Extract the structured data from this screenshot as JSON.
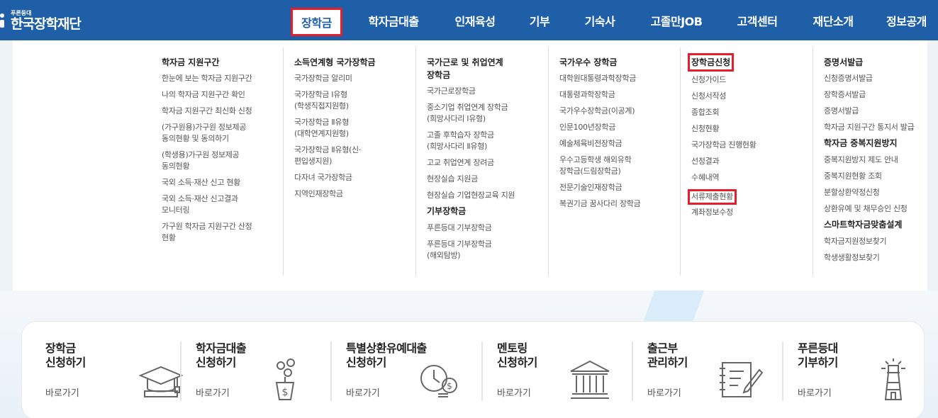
{
  "header": {
    "logo_sub": "푸른등대",
    "logo_main": "한국장학재단",
    "nav": [
      {
        "label": "장학금",
        "active": true
      },
      {
        "label": "학자금대출"
      },
      {
        "label": "인재육성"
      },
      {
        "label": "기부"
      },
      {
        "label": "기숙사"
      },
      {
        "label": "고졸만JOB"
      },
      {
        "label": "고객센터"
      },
      {
        "label": "재단소개"
      },
      {
        "label": "정보공개"
      }
    ]
  },
  "menu": {
    "col1": {
      "title": "학자금 지원구간",
      "links": [
        "한눈에 보는 학자금 지원구간",
        "나의 학자금 지원구간 확인",
        "학자금 지원구간 최신화 신청",
        "(가구원용)가구원 정보제공\n동의현황 및 동의하기",
        "(학생용)가구원 정보제공\n동의현황",
        "국외 소득·재산 신고 현황",
        "국외 소득·재산 신고결과\n모니터링",
        "가구원 학자금 지원구간 산정\n현황"
      ]
    },
    "col2": {
      "title": "소득연계형 국가장학금",
      "links": [
        "국가장학금 알리미",
        "국가장학금 Ⅰ유형\n(학생직접지원형)",
        "국가장학금 Ⅱ유형\n(대학연계지원형)",
        "국가장학금 Ⅱ유형(신·\n편입생지원)",
        "다자녀 국가장학금",
        "지역인재장학금"
      ]
    },
    "col3": {
      "title": "국가근로 및 취업연계\n장학금",
      "links": [
        "국가근로장학금",
        "중소기업 취업연계 장학금\n(희망사다리 Ⅰ유형)",
        "고졸 후학습자 장학금\n(희망사다리 Ⅱ유형)",
        "고교 취업연계 장려금",
        "현장실습 지원금",
        "현장실습 기업현장교육 지원"
      ],
      "subtitle": "기부장학금",
      "sublinks": [
        "푸른등대 기부장학금",
        "푸른등대 기부장학금\n(해외탐방)"
      ]
    },
    "col4": {
      "title": "국가우수 장학금",
      "links": [
        "대학원대통령과학장학금",
        "대통령과학장학금",
        "국가우수장학금(이공계)",
        "인문100년장학금",
        "예술체육비전장학금",
        "우수고등학생 해외유학\n장학금(드림장학금)",
        "전문기술인재장학금",
        "복권기금 꿈사다리 장학금"
      ]
    },
    "col5": {
      "title": "장학금신청",
      "links": [
        "신청가이드",
        "신청서작성",
        "종합조회",
        "신청현황",
        "국가장학금 진행현황",
        "선정결과",
        "수혜내역",
        "서류제출현황",
        "계좌정보수정"
      ]
    },
    "col6": {
      "title": "증명서발급",
      "links": [
        "신청증명서발급",
        "장학증서발급",
        "증명서발급",
        "학자금 지원구간 통지서 발급"
      ],
      "subtitle": "학자금 중복지원방지",
      "sublinks": [
        "중복지원방지 제도 안내",
        "중복지원현황 조회",
        "분할상환약정신청",
        "상환유예 및 채무승인 신청"
      ],
      "subtitle2": "스마트학자금맞춤설계",
      "sublinks2": [
        "학자금지원정보찾기",
        "학생생활정보찾기"
      ]
    }
  },
  "quick": [
    {
      "title": "장학금\n신청하기",
      "go": "바로가기",
      "icon": "graduation-cap-icon"
    },
    {
      "title": "학자금대출\n신청하기",
      "go": "바로가기",
      "icon": "money-plant-icon"
    },
    {
      "title": "특별상환유예대출\n신청하기",
      "go": "바로가기",
      "icon": "clock-coins-icon"
    },
    {
      "title": "멘토링\n신청하기",
      "go": "바로가기",
      "icon": "institution-icon"
    },
    {
      "title": "출근부\n관리하기",
      "go": "바로가기",
      "icon": "notebook-pen-icon"
    },
    {
      "title": "푸른등대\n기부하기",
      "go": "바로가기",
      "icon": "lighthouse-icon"
    }
  ],
  "colors": {
    "brand": "#1f5fa8",
    "highlight": "#e61e2b"
  }
}
